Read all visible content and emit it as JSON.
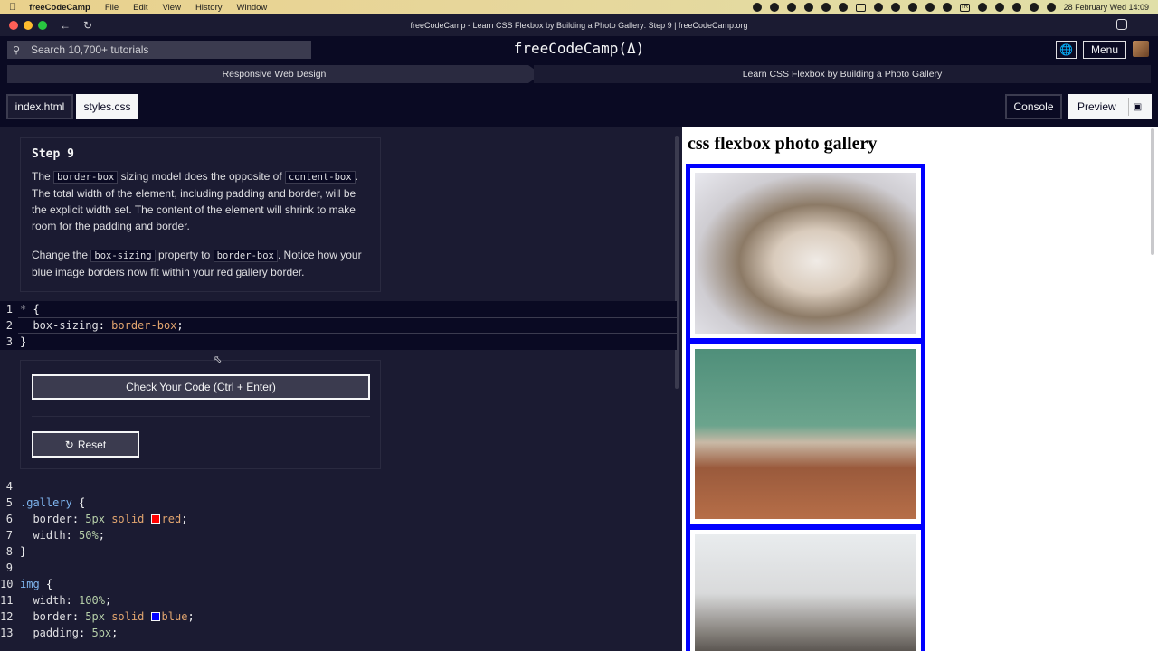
{
  "macbar": {
    "app": "freeCodeCamp",
    "menus": [
      "File",
      "Edit",
      "View",
      "History",
      "Window"
    ],
    "input_source": "TR",
    "datetime": "28 February Wed  14:09"
  },
  "browser": {
    "title": "freeCodeCamp - Learn CSS Flexbox by Building a Photo Gallery: Step 9 | freeCodeCamp.org"
  },
  "fcc_nav": {
    "search_placeholder": "Search 10,700+ tutorials",
    "brand": "freeCodeCamp(Δ)",
    "menu_label": "Menu"
  },
  "breadcrumb": {
    "superblock": "Responsive Web Design",
    "block": "Learn CSS Flexbox by Building a Photo Gallery"
  },
  "tabs": {
    "index": "index.html",
    "styles": "styles.css",
    "console": "Console",
    "preview": "Preview"
  },
  "step": {
    "title": "Step 9",
    "p1_a": "The ",
    "p1_code1": "border-box",
    "p1_b": " sizing model does the opposite of ",
    "p1_code2": "content-box",
    "p1_c": ". The total width of the element, including padding and border, will be the explicit width set. The content of the element will shrink to make room for the padding and border.",
    "p2_a": "Change the ",
    "p2_code1": "box-sizing",
    "p2_b": " property to ",
    "p2_code2": "border-box",
    "p2_c": ". Notice how your blue image borders now fit within your red gallery border."
  },
  "code": {
    "lines": [
      {
        "n": "1",
        "text": "* {"
      },
      {
        "n": "2",
        "prop": "box-sizing",
        "val": "border-box"
      },
      {
        "n": "3",
        "text": "}"
      },
      {
        "n": "4",
        "text": ""
      },
      {
        "n": "5",
        "sel": ".gallery",
        "brace": " {"
      },
      {
        "n": "6",
        "prop": "border",
        "num": "5px",
        "val": "solid",
        "color": "red"
      },
      {
        "n": "7",
        "prop": "width",
        "num": "50%"
      },
      {
        "n": "8",
        "text": "}"
      },
      {
        "n": "9",
        "text": ""
      },
      {
        "n": "10",
        "sel": "img",
        "brace": " {"
      },
      {
        "n": "11",
        "prop": "width",
        "num": "100%"
      },
      {
        "n": "12",
        "prop": "border",
        "num": "5px",
        "val": "solid",
        "color": "blue"
      },
      {
        "n": "13",
        "prop": "padding",
        "num": "5px"
      }
    ]
  },
  "actions": {
    "check": "Check Your Code (Ctrl + Enter)",
    "reset": "Reset"
  },
  "preview": {
    "heading": "css flexbox photo gallery"
  },
  "colors": {
    "bg": "#0a0a23",
    "panel": "#1b1b32",
    "gallery_border": "red",
    "img_border": "blue"
  }
}
